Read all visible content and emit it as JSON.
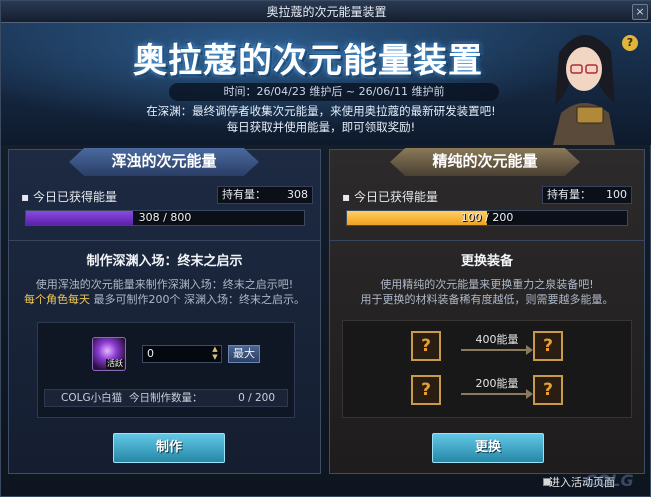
{
  "window": {
    "title": "奥拉蔻的次元能量装置",
    "close_label": "×"
  },
  "banner": {
    "title": "奥拉蔻的次元能量装置",
    "period": "时间：26/04/23 维护后 ~ 26/06/11 维护前",
    "desc_line1": "在深渊：最终调停者收集次元能量，来使用奥拉蔻的最新研发装置吧!",
    "desc_line2": "每日获取并使用能量，即可领取奖励!",
    "help_label": "?"
  },
  "left_panel": {
    "header": "浑浊的次元能量",
    "today_label": "今日已获得能量",
    "holding_label": "持有量：",
    "holding_value": "308",
    "progress_text": "308 / 800",
    "progress_current": 308,
    "progress_max": 800,
    "section_title": "制作深渊入场：终末之启示",
    "desc_line1": "使用浑浊的次元能量来制作深渊入场：终末之启示吧!",
    "desc_highlight": "每个角色每天",
    "desc_line2_rest": "最多可制作200个 深渊入场：终末之启示。",
    "item_badge": "活跃",
    "quantity_value": "0",
    "max_label": "最大",
    "craft_user": "COLG小白猫",
    "craft_label": "今日制作数量：",
    "craft_count": "0 / 200",
    "action_label": "制作"
  },
  "right_panel": {
    "header": "精纯的次元能量",
    "today_label": "今日已获得能量",
    "holding_label": "持有量：",
    "holding_value": "100",
    "progress_text": "100 / 200",
    "progress_current": 100,
    "progress_max": 200,
    "section_title": "更换装备",
    "desc_line1": "使用精纯的次元能量来更换重力之泉装备吧!",
    "desc_line2": "用于更换的材料装备稀有度越低，则需要越多能量。",
    "tier1_cost": "400能量",
    "tier2_cost": "200能量",
    "mystery_glyph": "?",
    "action_label": "更换"
  },
  "footer": {
    "link_label": "进入活动页面",
    "watermark": "COLG"
  },
  "colors": {
    "left_progress": "#8a4ae0",
    "right_progress": "#f0a020"
  }
}
